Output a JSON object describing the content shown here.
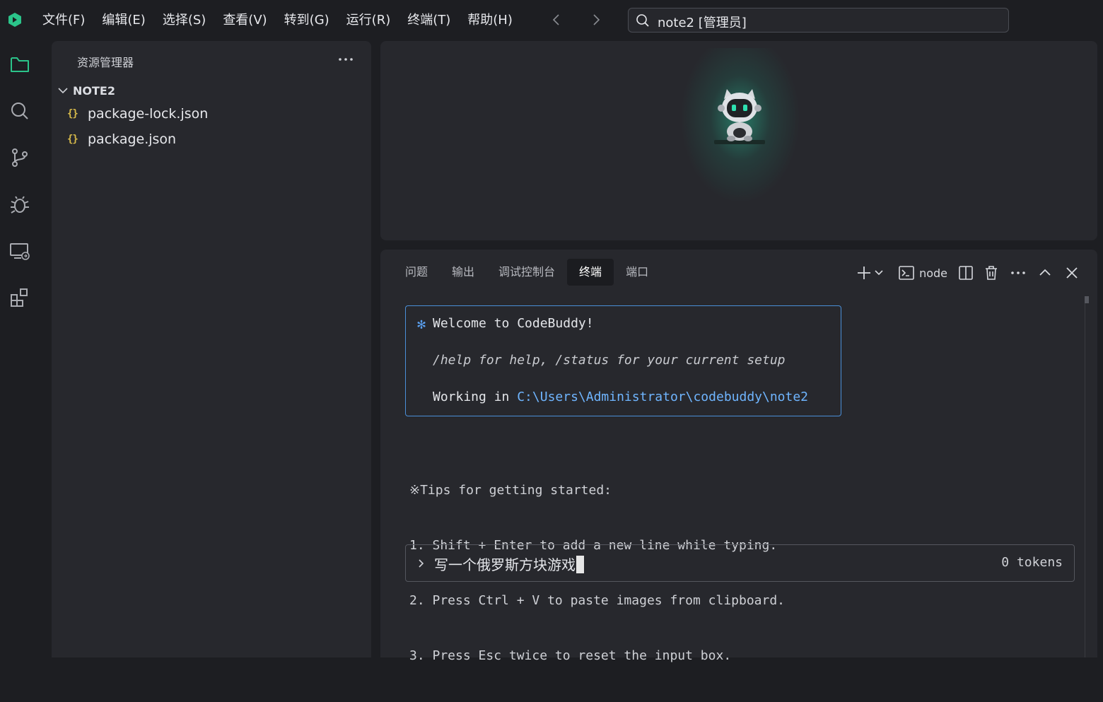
{
  "menu": [
    "文件(F)",
    "编辑(E)",
    "选择(S)",
    "查看(V)",
    "转到(G)",
    "运行(R)",
    "终端(T)",
    "帮助(H)"
  ],
  "search": {
    "text": "note2 [管理员]"
  },
  "explorer": {
    "title": "资源管理器",
    "folder": "NOTE2",
    "files": [
      {
        "name": "package-lock.json",
        "icon": "{}"
      },
      {
        "name": "package.json",
        "icon": "{}"
      }
    ]
  },
  "terminal": {
    "tabs": [
      "问题",
      "输出",
      "调试控制台",
      "终端",
      "端口"
    ],
    "active_tab": "终端",
    "shell_label": "node",
    "welcome_star": "✻",
    "welcome_title": "Welcome to CodeBuddy!",
    "welcome_help": "/help for help, /status for your current setup",
    "working_in_label": "Working in ",
    "working_path": "C:\\Users\\Administrator\\codebuddy\\note2",
    "tips_title": "※Tips for getting started:",
    "tips": [
      "1. Shift + Enter to add a new line while typing.",
      "2. Press Ctrl + V to paste images from clipboard.",
      "3. Press Esc twice to reset the input box."
    ],
    "input_text": "写一个俄罗斯方块游戏",
    "tokens": "0 tokens"
  },
  "colors": {
    "accent": "#4a8fd8",
    "brand": "#2bc48a",
    "path": "#6fb5ff",
    "json_icon": "#d7ba4a"
  }
}
